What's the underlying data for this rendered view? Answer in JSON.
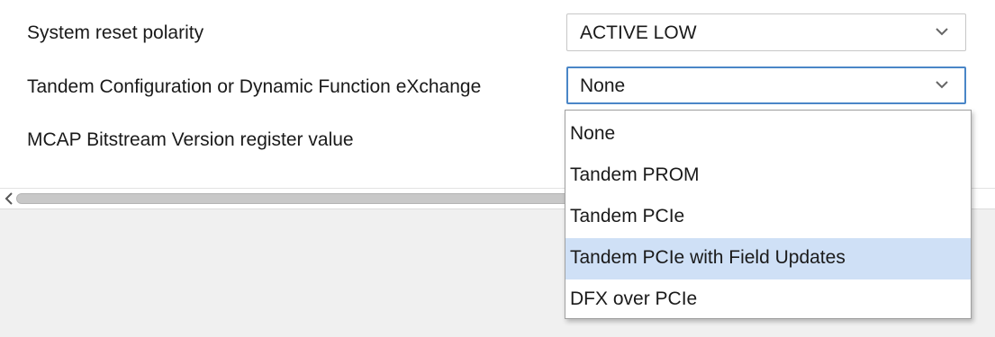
{
  "rows": [
    {
      "label": "System reset polarity",
      "value": "ACTIVE LOW"
    },
    {
      "label": "Tandem Configuration or Dynamic Function eXchange",
      "value": "None"
    },
    {
      "label": "MCAP Bitstream Version register value"
    }
  ],
  "dropdown": {
    "options": [
      "None",
      "Tandem PROM",
      "Tandem PCIe",
      "Tandem PCIe with Field Updates",
      "DFX over PCIe"
    ],
    "highlighted_index": 3
  },
  "colors": {
    "focus_border": "#4a86c7",
    "highlight": "#cfe0f6",
    "panel": "#f0f0f0"
  },
  "icons": {
    "combo_arrow": "chevron-down-icon",
    "scroll_left": "chevron-left-icon"
  }
}
